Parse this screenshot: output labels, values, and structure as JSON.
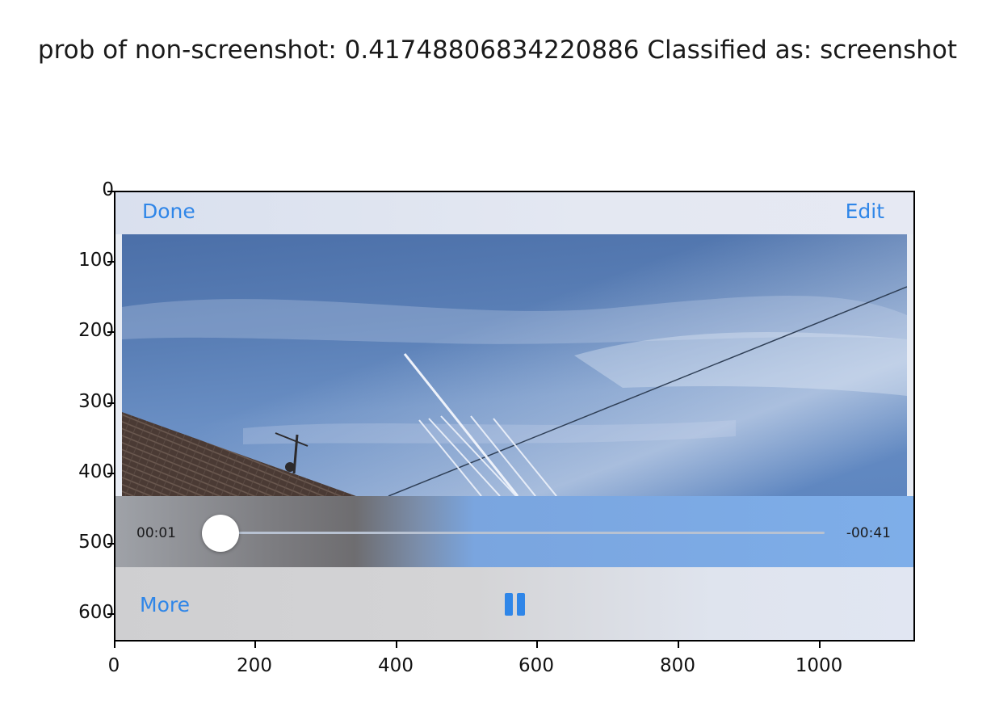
{
  "figure": {
    "title": "prob of non-screenshot: 0.41748806834220886 Classified as: screenshot"
  },
  "axes": {
    "y_ticks": [
      "0",
      "100",
      "200",
      "300",
      "400",
      "500",
      "600"
    ],
    "x_ticks": [
      "0",
      "200",
      "400",
      "600",
      "800",
      "1000"
    ]
  },
  "screen": {
    "nav": {
      "done_label": "Done",
      "edit_label": "Edit"
    },
    "player": {
      "elapsed": "00:01",
      "remaining": "-00:41",
      "progress_fraction": 0.024
    },
    "toolbar": {
      "more_label": "More",
      "pause_icon": "pause-icon"
    },
    "colors": {
      "accent": "#2f86e8"
    }
  }
}
